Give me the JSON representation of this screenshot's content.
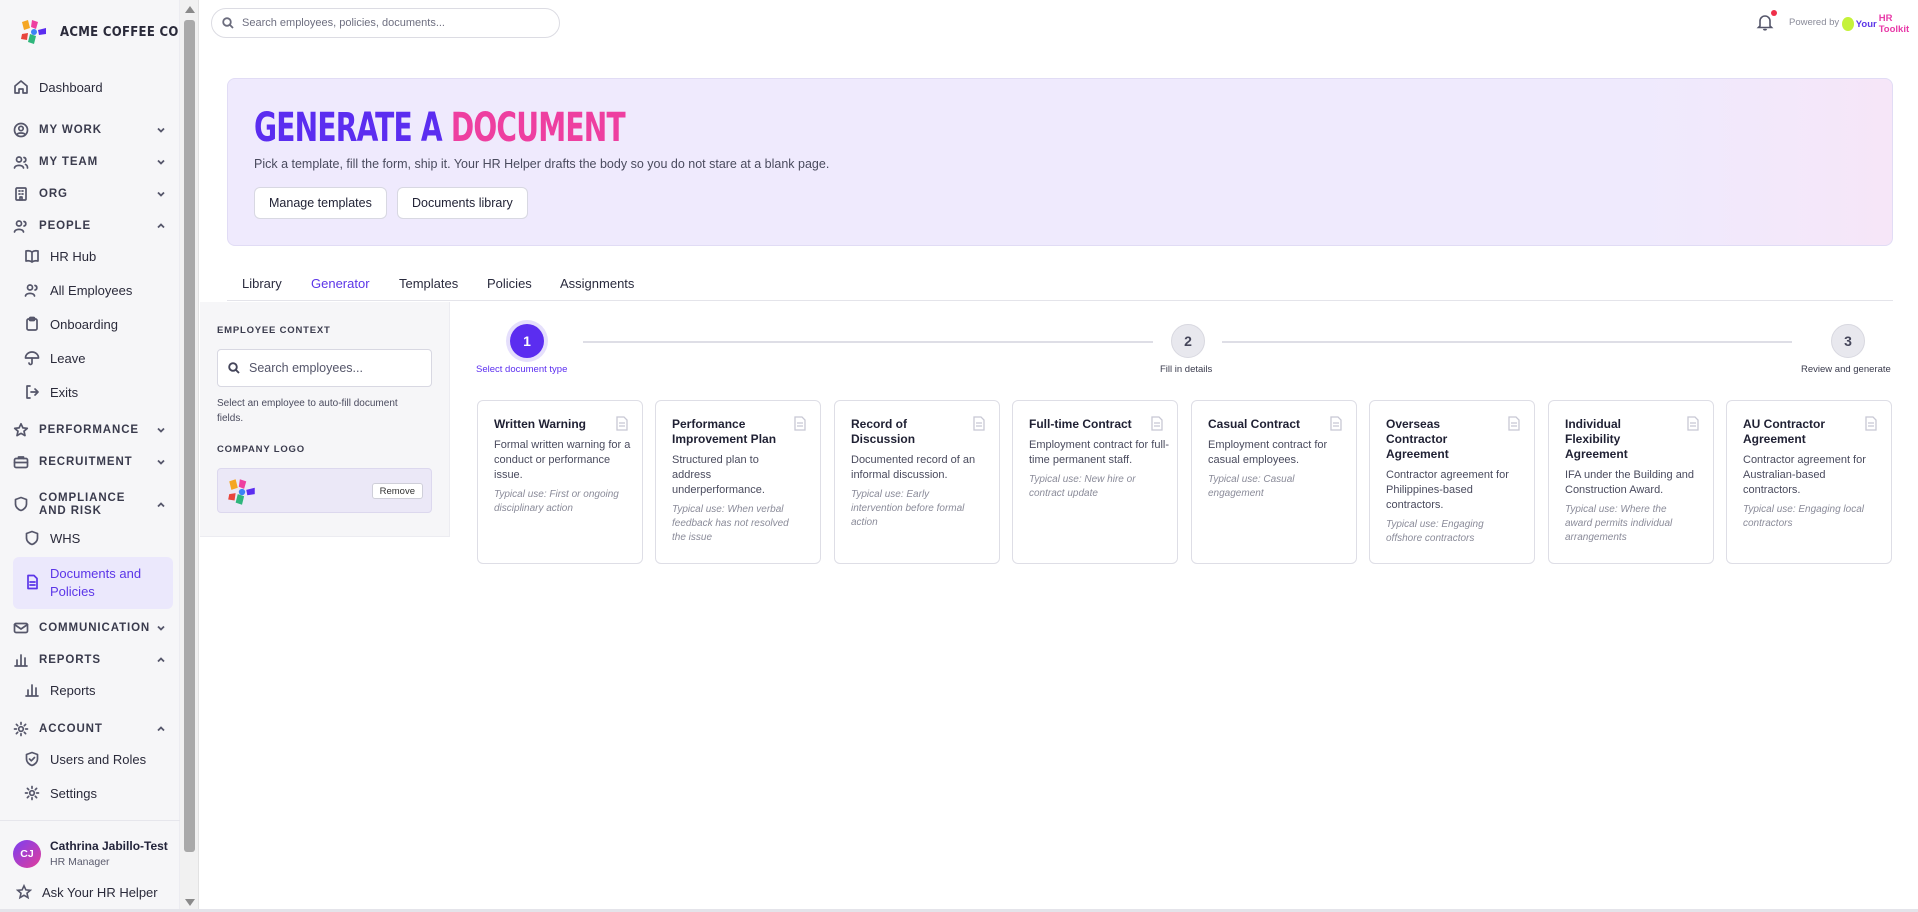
{
  "app": {
    "brand": "ACME COFFEE CO"
  },
  "search": {
    "placeholder": "Search employees, policies, documents..."
  },
  "header": {
    "powered_by": "Powered by",
    "powered_brand_1": "Your ",
    "powered_brand_2": "HR Toolkit"
  },
  "sidebar": {
    "dashboard": "Dashboard",
    "my_work": "MY WORK",
    "my_team": "MY TEAM",
    "org": "ORG",
    "people": "PEOPLE",
    "hr_hub": "HR Hub",
    "all_employees": "All Employees",
    "onboarding": "Onboarding",
    "leave": "Leave",
    "exits": "Exits",
    "performance": "PERFORMANCE",
    "recruitment": "RECRUITMENT",
    "compliance": "COMPLIANCE AND RISK",
    "whs": "WHS",
    "docs_policies": "Documents and Policies",
    "communication": "COMMUNICATION",
    "reports_section": "REPORTS",
    "reports": "Reports",
    "account": "ACCOUNT",
    "users_roles": "Users and Roles",
    "settings": "Settings"
  },
  "user": {
    "initials": "CJ",
    "name": "Cathrina Jabillo-Test",
    "role": "HR Manager"
  },
  "ask": "Ask Your HR Helper",
  "hero": {
    "title_a": "GENERATE A ",
    "title_b": "DOCUMENT",
    "subtitle": "Pick a template, fill the form, ship it. Your HR Helper drafts the body so you do not stare at a blank page.",
    "manage_btn": "Manage templates",
    "library_btn": "Documents library"
  },
  "tabs": [
    "Library",
    "Generator",
    "Templates",
    "Policies",
    "Assignments"
  ],
  "active_tab": "Generator",
  "context": {
    "employee_label": "EMPLOYEE CONTEXT",
    "search_placeholder": "Search employees...",
    "help": "Select an employee to auto-fill document fields.",
    "logo_label": "COMPANY LOGO",
    "remove": "Remove"
  },
  "steps": [
    {
      "num": "1",
      "label": "Select document type",
      "state": "active"
    },
    {
      "num": "2",
      "label": "Fill in details",
      "state": "idle"
    },
    {
      "num": "3",
      "label": "Review and generate",
      "state": "idle"
    }
  ],
  "cards": [
    {
      "title": "Written Warning",
      "desc": "Formal written warning for a conduct or performance issue.",
      "use": "Typical use: First or ongoing disciplinary action"
    },
    {
      "title": "Performance Improvement Plan",
      "desc": "Structured plan to address underperformance.",
      "use": "Typical use: When verbal feedback has not resolved the issue"
    },
    {
      "title": "Record of Discussion",
      "desc": "Documented record of an informal discussion.",
      "use": "Typical use: Early intervention before formal action"
    },
    {
      "title": "Full-time Contract",
      "desc": "Employment contract for full-time permanent staff.",
      "use": "Typical use: New hire or contract update"
    },
    {
      "title": "Casual Contract",
      "desc": "Employment contract for casual employees.",
      "use": "Typical use: Casual engagement"
    },
    {
      "title": "Overseas Contractor Agreement",
      "desc": "Contractor agreement for Philippines-based contractors.",
      "use": "Typical use: Engaging offshore contractors"
    },
    {
      "title": "Individual Flexibility Agreement",
      "desc": "IFA under the Building and Construction Award.",
      "use": "Typical use: Where the award permits individual arrangements"
    },
    {
      "title": "AU Contractor Agreement",
      "desc": "Contractor agreement for Australian-based contractors.",
      "use": "Typical use: Engaging local contractors"
    }
  ],
  "colors": {
    "accent": "#5b2df0",
    "accent_pink": "#ee3fa0",
    "hero_bg": "#efeafd"
  }
}
